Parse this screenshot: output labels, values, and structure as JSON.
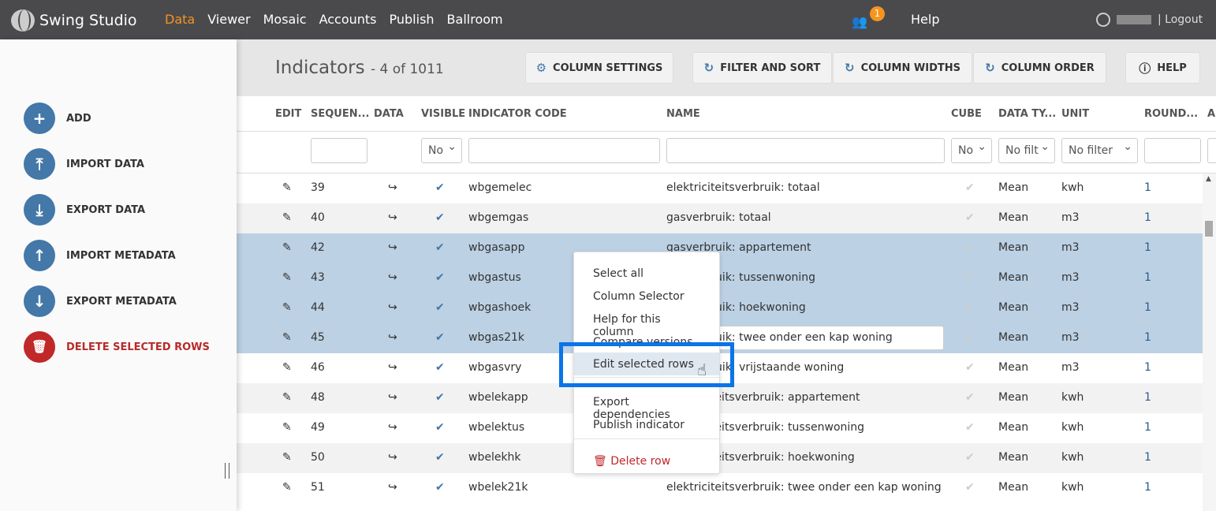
{
  "app": {
    "title": "Swing Studio",
    "nav": [
      "Data",
      "Viewer",
      "Mosaic",
      "Accounts",
      "Publish",
      "Ballroom"
    ],
    "active_nav": "Data",
    "notification_count": "1",
    "help": "Help",
    "logout": "| Logout"
  },
  "sidebar": {
    "items": [
      {
        "label": "ADD",
        "icon": "plus-icon"
      },
      {
        "label": "IMPORT DATA",
        "icon": "upload-icon"
      },
      {
        "label": "EXPORT DATA",
        "icon": "download-icon"
      },
      {
        "label": "IMPORT METADATA",
        "icon": "arrow-up-icon"
      },
      {
        "label": "EXPORT METADATA",
        "icon": "arrow-down-icon"
      },
      {
        "label": "DELETE SELECTED ROWS",
        "icon": "trash-icon"
      }
    ]
  },
  "page": {
    "title": "Indicators",
    "count": "- 4 of 1011"
  },
  "toolbar": {
    "column_settings": "COLUMN SETTINGS",
    "filter_sort": "FILTER AND SORT",
    "column_widths": "COLUMN WIDTHS",
    "column_order": "COLUMN ORDER",
    "help": "HELP"
  },
  "table": {
    "headers": [
      "EDIT",
      "SEQUEN...",
      "DATA",
      "VISIBLE",
      "INDICATOR CODE",
      "NAME",
      "CUBE",
      "DATA TY...",
      "UNIT",
      "ROUND...",
      "A"
    ],
    "filters": {
      "visible": "No",
      "cube": "No",
      "data_type": "No filt",
      "unit": "No filter"
    },
    "rows": [
      {
        "seq": "39",
        "code": "wbgemelec",
        "name": "elektriciteitsverbruik: totaal",
        "type": "Mean",
        "unit": "kwh",
        "round": "1",
        "state": "normal"
      },
      {
        "seq": "40",
        "code": "wbgemgas",
        "name": "gasverbruik: totaal",
        "type": "Mean",
        "unit": "m3",
        "round": "1",
        "state": "alt"
      },
      {
        "seq": "42",
        "code": "wbgasapp",
        "name": "gasverbruik: appartement",
        "type": "Mean",
        "unit": "m3",
        "round": "1",
        "state": "sel"
      },
      {
        "seq": "43",
        "code": "wbgastus",
        "name": "gasverbruik: tussenwoning",
        "type": "Mean",
        "unit": "m3",
        "round": "1",
        "state": "sel"
      },
      {
        "seq": "44",
        "code": "wbgashoek",
        "name": "gasverbruik: hoekwoning",
        "type": "Mean",
        "unit": "m3",
        "round": "1",
        "state": "sel"
      },
      {
        "seq": "45",
        "code": "wbgas21k",
        "name": "gasverbruik: twee onder een kap woning",
        "type": "Mean",
        "unit": "m3",
        "round": "1",
        "state": "sel"
      },
      {
        "seq": "46",
        "code": "wbgasvry",
        "name": "gasverbruik: vrijstaande woning",
        "type": "Mean",
        "unit": "m3",
        "round": "1",
        "state": "normal"
      },
      {
        "seq": "48",
        "code": "wbelekapp",
        "name": "elektriciteitsverbruik: appartement",
        "type": "Mean",
        "unit": "kwh",
        "round": "1",
        "state": "alt"
      },
      {
        "seq": "49",
        "code": "wbelektus",
        "name": "elektriciteitsverbruik: tussenwoning",
        "type": "Mean",
        "unit": "kwh",
        "round": "1",
        "state": "normal"
      },
      {
        "seq": "50",
        "code": "wbelekhk",
        "name": "elektriciteitsverbruik: hoekwoning",
        "type": "Mean",
        "unit": "kwh",
        "round": "1",
        "state": "alt"
      },
      {
        "seq": "51",
        "code": "wbelek21k",
        "name": "elektriciteitsverbruik: twee onder een kap woning",
        "type": "Mean",
        "unit": "kwh",
        "round": "1",
        "state": "normal"
      }
    ]
  },
  "context_menu": {
    "items": [
      "Select all",
      "Column Selector",
      "Help for this column",
      "Compare versions",
      "Edit selected rows",
      "Export dependencies",
      "Publish indicator",
      "Delete row"
    ],
    "highlighted": "Edit selected rows"
  },
  "colors": {
    "topbar": "#4a4a4c",
    "accent": "#f7931e",
    "primary": "#4378a8",
    "danger": "#c0282a",
    "selected_row": "#bcd1e4",
    "highlight_box": "#0a74e8"
  }
}
